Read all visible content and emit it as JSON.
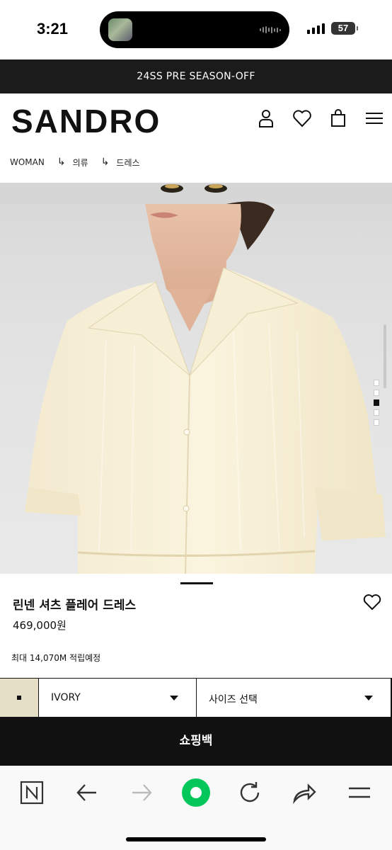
{
  "status_bar": {
    "time": "3:21",
    "battery": "57"
  },
  "promo_banner": {
    "text": "24SS PRE SEASON-OFF"
  },
  "header": {
    "logo": "SANDRO",
    "icons": [
      "account-icon",
      "wishlist-heart-icon",
      "shopping-bag-icon",
      "menu-icon"
    ]
  },
  "breadcrumb": {
    "items": [
      "WOMAN",
      "의류",
      "드레스"
    ],
    "separator": "↳"
  },
  "gallery": {
    "image_count": 5,
    "active_index": 2
  },
  "product": {
    "name": "린넨 셔츠 플레어 드레스",
    "price": "469,000원",
    "points": "최대 14,070M 적립예정"
  },
  "options": {
    "color_label": "IVORY",
    "swatch_color": "#e6dfc7",
    "size_label": "사이즈 선택"
  },
  "cta": {
    "add_to_bag": "쇼핑백"
  },
  "browser_toolbar": {
    "icons": [
      "naver-n-icon",
      "back-arrow-icon",
      "forward-arrow-icon",
      "green-home-icon",
      "refresh-icon",
      "share-icon",
      "menu-lines-icon"
    ],
    "accent": "#03c75a"
  }
}
